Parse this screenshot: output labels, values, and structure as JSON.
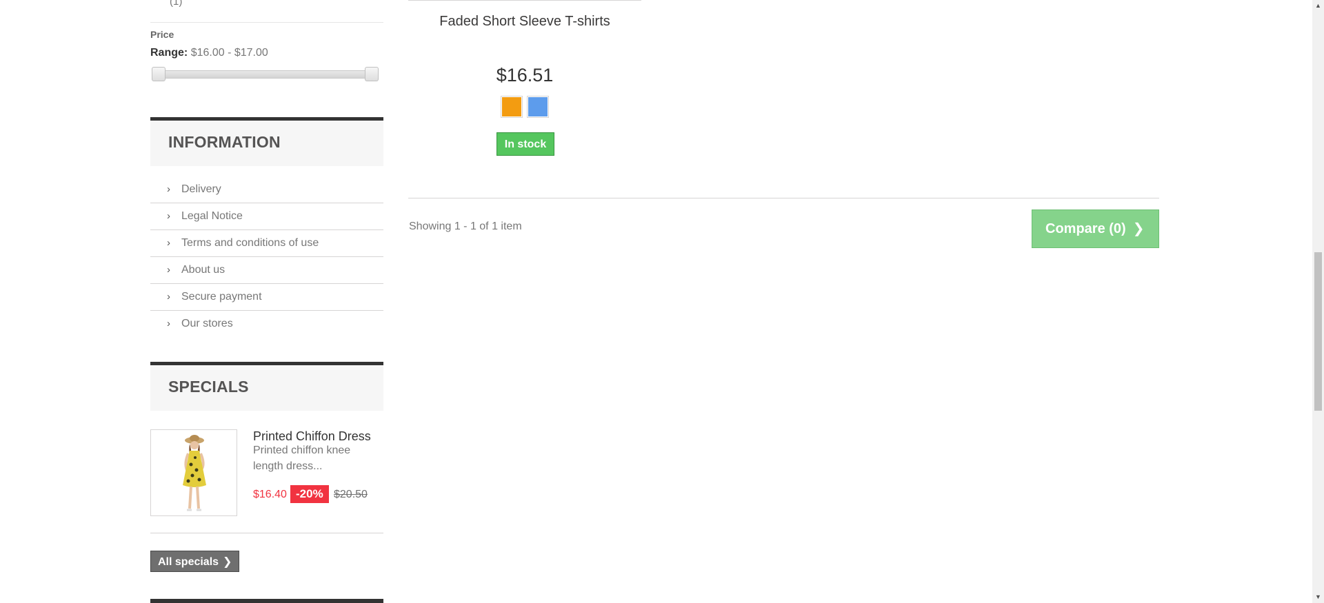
{
  "filters": {
    "previous_item_label": "(1)"
  },
  "price_filter": {
    "title": "Price",
    "range_label": "Range:",
    "range_value": "$16.00 - $17.00",
    "slider_min": 16.0,
    "slider_max": 17.0
  },
  "information": {
    "title": "INFORMATION",
    "items": [
      {
        "label": "Delivery"
      },
      {
        "label": "Legal Notice"
      },
      {
        "label": "Terms and conditions of use"
      },
      {
        "label": "About us"
      },
      {
        "label": "Secure payment"
      },
      {
        "label": "Our stores"
      }
    ]
  },
  "specials": {
    "title": "SPECIALS",
    "item": {
      "name": "Printed Chiffon Dress",
      "description": "Printed chiffon knee length dress...",
      "price": "$16.40",
      "discount": "-20%",
      "old_price": "$20.50"
    },
    "all_button": "All specials"
  },
  "product": {
    "name": "Faded Short Sleeve T-shirts",
    "price": "$16.51",
    "colors": [
      {
        "name": "orange-swatch",
        "hex": "#f39c11"
      },
      {
        "name": "blue-swatch",
        "hex": "#5d9cec"
      }
    ],
    "availability": "In stock"
  },
  "listing": {
    "showing": "Showing 1 - 1 of 1 item",
    "compare_button": "Compare (0)"
  },
  "colors": {
    "in_stock_green": "#55c65e",
    "compare_green": "#85d38b",
    "sale_red": "#f13340",
    "block_border": "#333333"
  },
  "icons": {
    "chevron": "chevron-right-icon"
  }
}
